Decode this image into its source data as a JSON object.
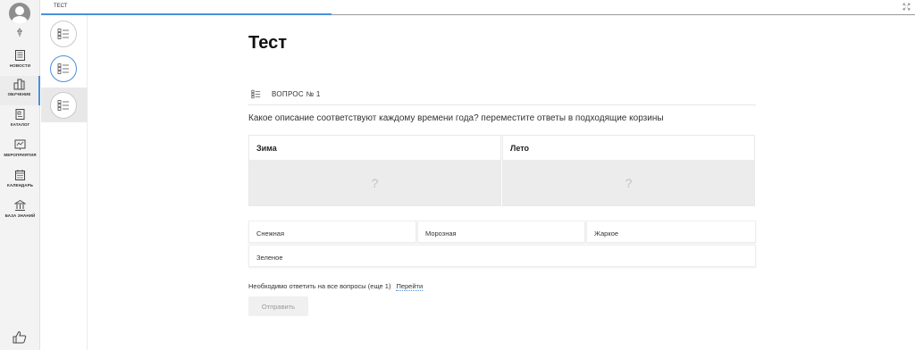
{
  "nav": {
    "items": [
      {
        "label": "НОВОСТИ",
        "icon": "newspaper-icon"
      },
      {
        "label": "ОБУЧЕНИЕ",
        "icon": "learning-icon"
      },
      {
        "label": "КАТАЛОГ",
        "icon": "catalog-icon"
      },
      {
        "label": "МЕРОПРИЯТИЯ",
        "icon": "events-icon"
      },
      {
        "label": "КАЛЕНДАРЬ",
        "icon": "calendar-icon"
      },
      {
        "label": "БАЗА ЗНАНИЙ",
        "icon": "knowledge-base-icon"
      }
    ],
    "active": "ОБУЧЕНИЕ"
  },
  "topbar": {
    "title": "ТЕСТ",
    "progress": 0.33
  },
  "page": {
    "title": "Тест"
  },
  "question": {
    "label": "ВОПРОС № 1",
    "text": "Какое описание соответствуют каждому времени года? переместите ответы в подходящие корзины"
  },
  "baskets": [
    {
      "title": "Зима",
      "placeholder": "?"
    },
    {
      "title": "Лето",
      "placeholder": "?"
    }
  ],
  "answers": [
    "Снежная",
    "Морозная",
    "Жаркое",
    "Зеленое"
  ],
  "note": {
    "text": "Необходимо ответить на все вопросы (еще 1)",
    "link": "Перейти"
  },
  "submit_label": "Отправить",
  "colors": {
    "accent": "#4a90d9",
    "nav_bg": "#f3f3f3",
    "dropzone": "#ececec"
  }
}
